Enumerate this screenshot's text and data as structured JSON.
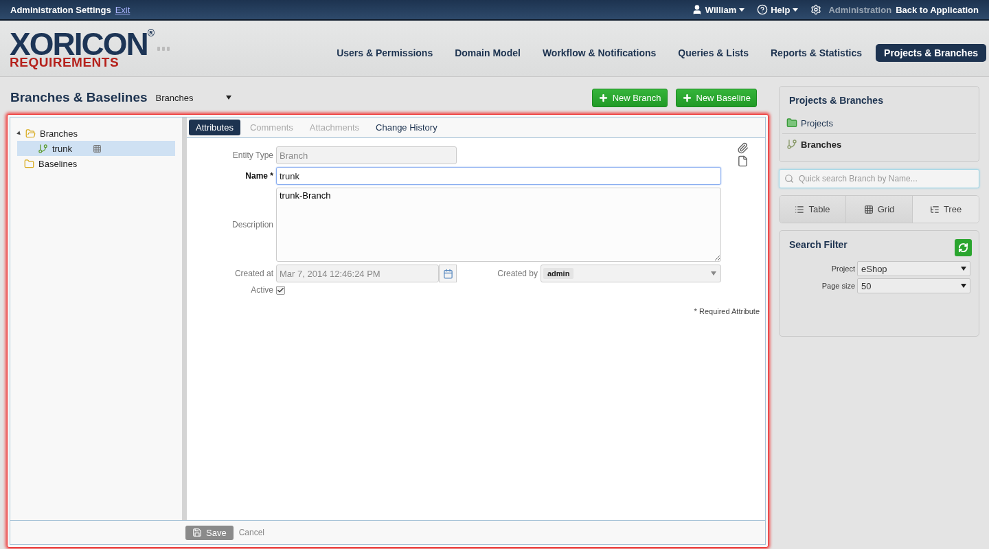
{
  "top_bar": {
    "title": "Administration Settings",
    "exit_link": "Exit",
    "user_menu": "William",
    "help_menu": "Help",
    "admin_label": "Administration",
    "back_link": "Back to Application"
  },
  "logo": {
    "name": "XORICON",
    "mark": "®",
    "subtitle": "REQUIREMENTS"
  },
  "nav": [
    {
      "label": "Users & Permissions",
      "selected": false
    },
    {
      "label": "Domain Model",
      "selected": false
    },
    {
      "label": "Workflow & Notifications",
      "selected": false
    },
    {
      "label": "Queries & Lists",
      "selected": false
    },
    {
      "label": "Reports & Statistics",
      "selected": false
    },
    {
      "label": "Projects & Branches",
      "selected": true
    }
  ],
  "page": {
    "title": "Branches & Baselines",
    "view_select": "Branches",
    "buttons": [
      "New Branch",
      "New Baseline"
    ]
  },
  "tree": [
    {
      "label": "Branches",
      "kind": "folder",
      "selected": false,
      "expanded": true,
      "children": [
        {
          "label": "trunk",
          "kind": "branch",
          "selected": true
        }
      ]
    },
    {
      "label": "Baselines",
      "kind": "folder",
      "selected": false
    }
  ],
  "tabs": [
    {
      "label": "Attributes",
      "selected": true,
      "disabled": false
    },
    {
      "label": "Comments",
      "selected": false,
      "disabled": true
    },
    {
      "label": "Attachments",
      "selected": false,
      "disabled": true
    },
    {
      "label": "Change History",
      "selected": false,
      "disabled": false
    }
  ],
  "form": {
    "entity_type": {
      "label": "Entity Type",
      "value": "Branch"
    },
    "name": {
      "label": "Name",
      "required_mark": "*",
      "value": "trunk"
    },
    "description": {
      "label": "Description",
      "value": "trunk-Branch"
    },
    "created_at": {
      "label": "Created at",
      "value": "Mar 7, 2014 12:46:24 PM"
    },
    "created_by": {
      "label": "Created by",
      "value": "admin"
    },
    "active": {
      "label": "Active",
      "checked": true
    },
    "required_note": "* Required Attribute"
  },
  "footer": {
    "save": "Save",
    "cancel": "Cancel"
  },
  "sidebar": {
    "title": "Projects & Branches",
    "items": [
      {
        "label": "Projects",
        "kind": "projects",
        "selected": false
      },
      {
        "label": "Branches",
        "kind": "branches",
        "selected": true
      }
    ],
    "search": {
      "placeholder": "Quick search Branch by Name..."
    },
    "view_modes": [
      {
        "label": "Table",
        "kind": "table",
        "selected": false
      },
      {
        "label": "Grid",
        "kind": "grid",
        "selected": false
      },
      {
        "label": "Tree",
        "kind": "tree",
        "selected": true
      }
    ],
    "filter": {
      "title": "Search Filter",
      "fields": [
        {
          "label": "Project",
          "value": "eShop"
        },
        {
          "label": "Page size",
          "value": "50"
        }
      ]
    }
  }
}
